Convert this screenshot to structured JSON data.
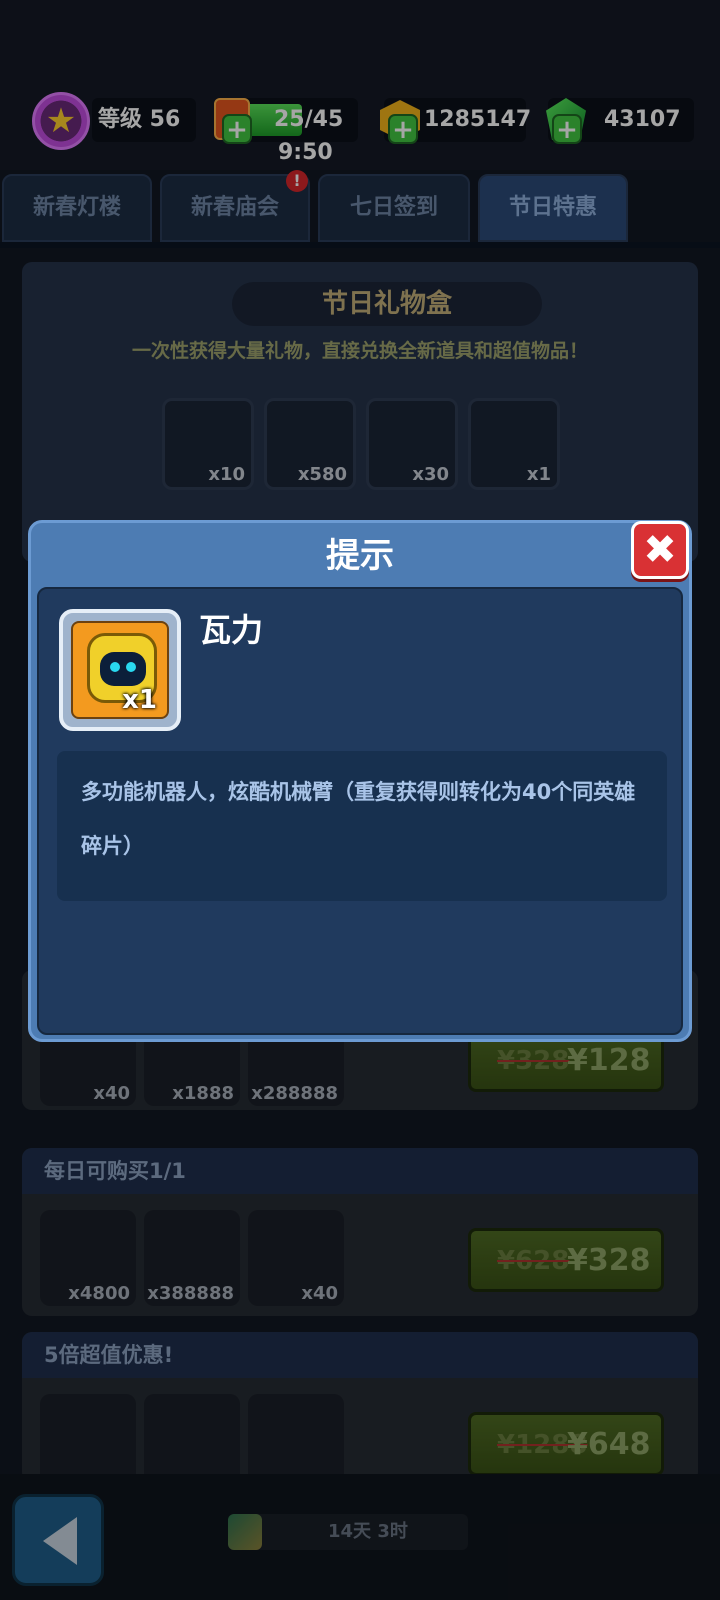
{
  "status": {
    "level_label": "等级 56",
    "energy": "25/45",
    "energy_timer": "9:50",
    "coins": "1285147",
    "gems": "43107"
  },
  "tabs": [
    {
      "label": "新春灯楼"
    },
    {
      "label": "新春庙会"
    },
    {
      "label": "七日签到"
    },
    {
      "label": "节日特惠"
    }
  ],
  "notification_badge": "!",
  "gift_box": {
    "title": "节日礼物盒",
    "subtitle": "一次性获得大量礼物，直接兑换全新道具和超值物品！",
    "items": [
      {
        "icon": "battery-icon",
        "qty": "x10"
      },
      {
        "icon": "green-gem-icon",
        "qty": "x580"
      },
      {
        "icon": "robot-fragment-icon",
        "qty": "x30"
      },
      {
        "icon": "robot-hero-icon",
        "qty": "x1"
      }
    ]
  },
  "deals": [
    {
      "header": "",
      "items": [
        {
          "icon": "hammer-icon",
          "qty": "x40"
        },
        {
          "icon": "battery-icon",
          "qty": "x1888"
        },
        {
          "icon": "coin-icon",
          "qty": "x288888"
        }
      ],
      "old_price": "¥328",
      "new_price": "¥128"
    },
    {
      "header": "每日可购买1/1",
      "items": [
        {
          "icon": "battery-icon",
          "qty": "x4800"
        },
        {
          "icon": "coin-icon",
          "qty": "x388888"
        },
        {
          "icon": "wrench-icon",
          "qty": "x40"
        }
      ],
      "old_price": "¥628",
      "new_price": "¥328"
    },
    {
      "header": "5倍超值优惠!",
      "items": [
        {
          "icon": "hammer-icon",
          "qty": ""
        },
        {
          "icon": "battery-icon",
          "qty": ""
        },
        {
          "icon": "coin-icon",
          "qty": ""
        }
      ],
      "old_price": "¥1288",
      "new_price": "¥648"
    }
  ],
  "bottom": {
    "countdown": "14天 3时"
  },
  "modal": {
    "title": "提示",
    "close_icon": "close-icon",
    "item_name": "瓦力",
    "item_qty": "x1",
    "description": "多功能机器人，炫酷机械臂（重复获得则转化为40个同英雄碎片）"
  },
  "colors": {
    "modal_frame": "#4d7cb3",
    "modal_body": "#203a5e",
    "close_button": "#d93134",
    "energy_bar": "#3fc641"
  }
}
